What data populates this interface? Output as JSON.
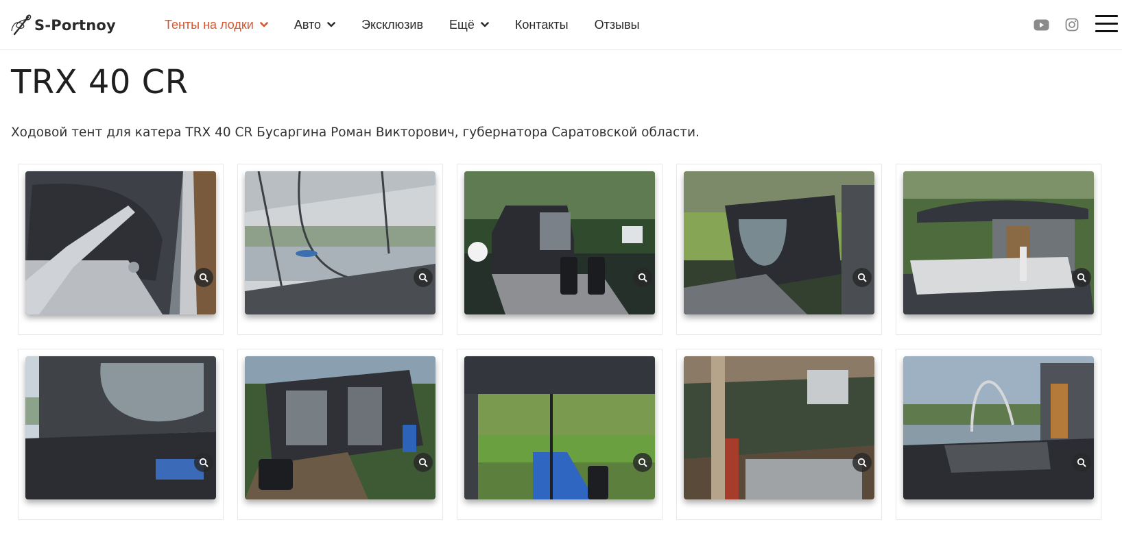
{
  "site": {
    "logo_text": "S-Portnoy",
    "logo_icon": "needle-thread-icon"
  },
  "nav": {
    "items": [
      {
        "label": "Тенты на лодки",
        "has_dropdown": true,
        "active": true
      },
      {
        "label": "Авто",
        "has_dropdown": true,
        "active": false
      },
      {
        "label": "Эксклюзив",
        "has_dropdown": false,
        "active": false
      },
      {
        "label": "Ещё",
        "has_dropdown": true,
        "active": false
      },
      {
        "label": "Контакты",
        "has_dropdown": false,
        "active": false
      },
      {
        "label": "Отзывы",
        "has_dropdown": false,
        "active": false
      }
    ],
    "active_color": "#d9532c",
    "text_color": "#2a2a2a"
  },
  "social": {
    "icons": [
      "youtube-icon",
      "instagram-icon"
    ],
    "icon_color": "#8a8a8a"
  },
  "menu_icon": "hamburger-menu-icon",
  "page": {
    "title": "TRX 40 CR",
    "description": "Ходовой тент для катера TRX 40 CR Бусаргина Роман Викторович, губернатора Саратовской области."
  },
  "gallery": {
    "zoom_icon": "magnifier-icon",
    "photos": [
      {
        "subject": "tent-roof-closeup"
      },
      {
        "subject": "tent-window-view"
      },
      {
        "subject": "boat-stern-night"
      },
      {
        "subject": "tent-side-window"
      },
      {
        "subject": "boat-open-deck"
      },
      {
        "subject": "tent-side-panel"
      },
      {
        "subject": "boat-tent-full"
      },
      {
        "subject": "tent-inside-view"
      },
      {
        "subject": "boat-hull-dock"
      },
      {
        "subject": "boat-deck-river"
      }
    ]
  }
}
